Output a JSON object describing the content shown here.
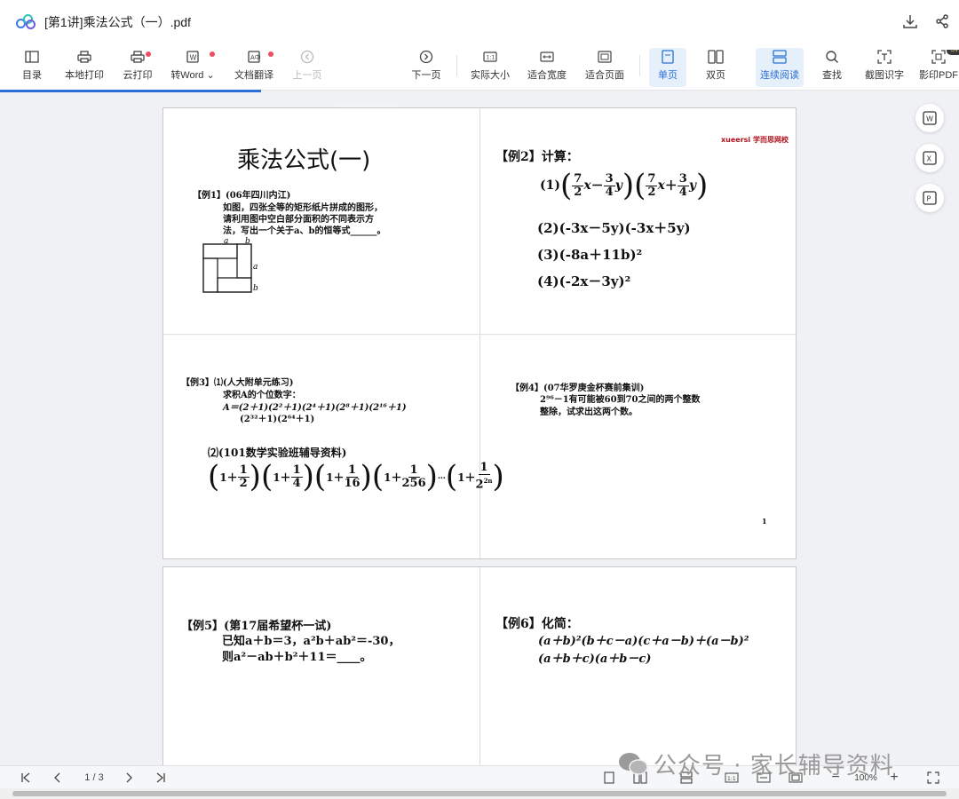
{
  "titlebar": {
    "title": "[第1讲]乘法公式（一）.pdf"
  },
  "toolbar": {
    "toc": "目录",
    "local_print": "本地打印",
    "cloud_print": "云打印",
    "to_word": "转Word",
    "translate": "文档翻译",
    "prev_page": "上一页",
    "page_indicator": "1  / 3",
    "next_page": "下一页",
    "actual_size": "实际大小",
    "fit_width": "适合宽度",
    "fit_page": "适合页面",
    "single_page": "单页",
    "double_page": "双页",
    "continuous": "连续阅读",
    "find": "查找",
    "ocr": "截图识字",
    "print_pdf": "影印PDF",
    "svip_badge": "SV"
  },
  "side_actions": {
    "word_icon_text": "W",
    "excel_icon_text": "X",
    "ppt_icon_text": "P"
  },
  "pdf": {
    "p1": {
      "title": "乘法公式(一)",
      "ex1_head": "【例1】(06年四川内江)",
      "ex1_l1": "如图，四张全等的矩形纸片拼成的图形，",
      "ex1_l2": "请利用图中空白部分面积的不同表示方",
      "ex1_l3": "法，写出一个关于a、b的恒等式______。",
      "label_a": "a",
      "label_b": "b",
      "brand": "xueersi 学而思网校",
      "ex2_head": "【例2】计算：",
      "ex2_1_num": "(1)",
      "ex2_2": "(2)(-3x－5y)(-3x＋5y)",
      "ex2_3": "(3)(-8a＋11b)²",
      "ex2_4": "(4)(-2x－3y)²",
      "ex3_head": "【例3】⑴(人大附单元练习)",
      "ex3_l1": "求积A的个位数字：",
      "ex3_l2": "A＝(2＋1)(2²＋1)(2⁴＋1)(2⁸＋1)(2¹⁶＋1)",
      "ex3_l3": "(2³²＋1)(2⁶⁴＋1)",
      "ex3_2_head": "⑵(101数学实验班辅导资料)",
      "ex4_head": "【例4】(07华罗庚金杯赛前集训)",
      "ex4_l1": "2⁹⁶－1有可能被60到70之间的两个整数",
      "ex4_l2": "整除，试求出这两个数。",
      "page_num": "1"
    },
    "p2": {
      "ex5_head": "【例5】(第17届希望杯一试)",
      "ex5_l1": "已知a＋b＝3，a²b＋ab²＝-30，",
      "ex5_l2": "则a²－ab＋b²＋11＝____。",
      "ex6_head": "【例6】化简：",
      "ex6_l1": "(a＋b)²(b＋c－a)(c＋a－b)＋(a－b)²",
      "ex6_l2": "(a＋b＋c)(a＋b－c)"
    }
  },
  "statusbar": {
    "page_indicator": "1  / 3",
    "zoom": "100%"
  },
  "watermark": "公众号 · 家长辅导资料"
}
